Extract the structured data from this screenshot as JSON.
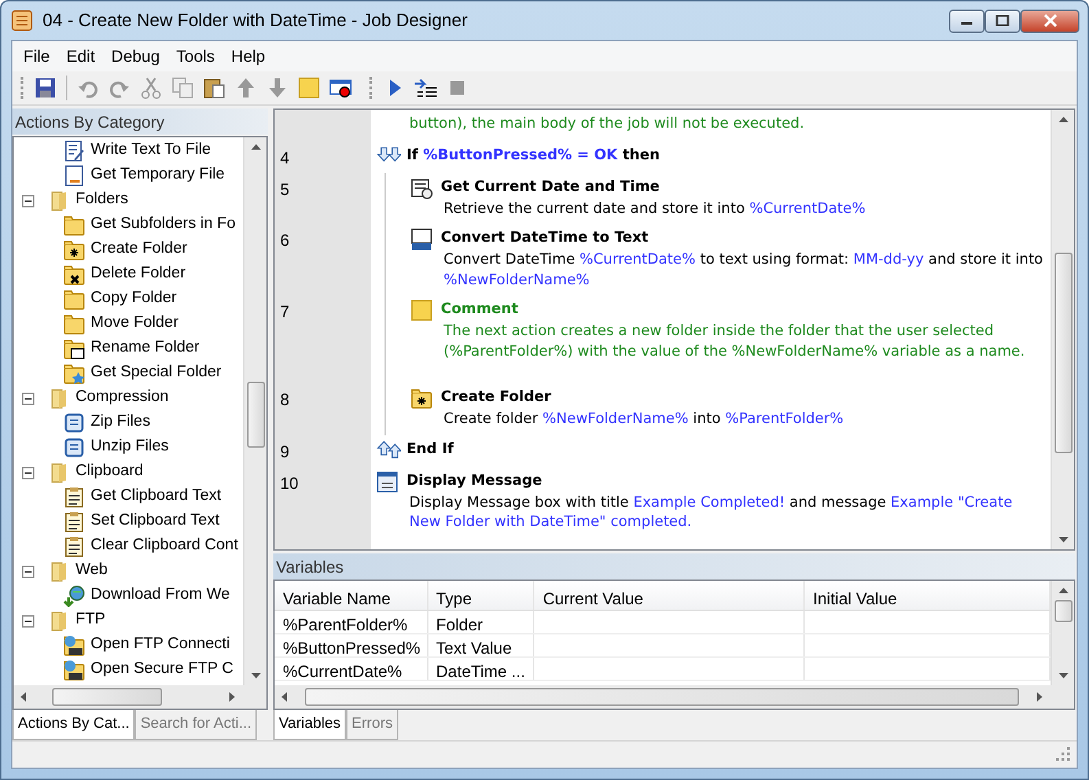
{
  "window": {
    "title": "04 - Create New Folder with DateTime - Job Designer"
  },
  "menu": [
    "File",
    "Edit",
    "Debug",
    "Tools",
    "Help"
  ],
  "actions_panel": {
    "title": "Actions By Category",
    "tree": [
      {
        "kind": "write",
        "label": "Write Text To File"
      },
      {
        "kind": "tempfile",
        "label": "Get Temporary File"
      },
      {
        "kind": "category",
        "label": "Folders",
        "expanded": true,
        "children": [
          {
            "kind": "folder",
            "label": "Get Subfolders in Fo"
          },
          {
            "kind": "folder-new",
            "label": "Create Folder"
          },
          {
            "kind": "folder-delete",
            "label": "Delete Folder"
          },
          {
            "kind": "folder",
            "label": "Copy Folder"
          },
          {
            "kind": "folder",
            "label": "Move Folder"
          },
          {
            "kind": "folder-rename",
            "label": "Rename Folder"
          },
          {
            "kind": "folder-special",
            "label": "Get Special Folder"
          }
        ]
      },
      {
        "kind": "category",
        "label": "Compression",
        "expanded": true,
        "children": [
          {
            "kind": "zip",
            "label": "Zip Files"
          },
          {
            "kind": "zip",
            "label": "Unzip Files"
          }
        ]
      },
      {
        "kind": "category",
        "label": "Clipboard",
        "expanded": true,
        "children": [
          {
            "kind": "clipboard",
            "label": "Get Clipboard Text"
          },
          {
            "kind": "clipboard",
            "label": "Set Clipboard Text"
          },
          {
            "kind": "clipboard",
            "label": "Clear Clipboard Cont"
          }
        ]
      },
      {
        "kind": "category",
        "label": "Web",
        "expanded": true,
        "children": [
          {
            "kind": "globe",
            "label": "Download From We"
          }
        ]
      },
      {
        "kind": "category",
        "label": "FTP",
        "expanded": true,
        "children": [
          {
            "kind": "ftp",
            "label": "Open FTP Connecti"
          },
          {
            "kind": "ftp",
            "label": "Open Secure FTP C"
          }
        ]
      }
    ],
    "tabs": [
      {
        "label": "Actions By Cat...",
        "selected": true
      },
      {
        "label": "Search for Acti...",
        "selected": false
      }
    ]
  },
  "editor": {
    "steps": [
      {
        "kind": "comment-tail",
        "parts": [
          {
            "text": "button), the main body of the job will not be executed."
          }
        ]
      },
      {
        "number": "4",
        "kind": "if",
        "parts": [
          {
            "text": "If ",
            "var": false
          },
          {
            "text": "%ButtonPressed% = OK",
            "var": true
          },
          {
            "text": " then",
            "var": false
          }
        ],
        "children": [
          {
            "number": "5",
            "kind": "date",
            "title": "Get Current Date and Time",
            "parts": [
              {
                "text": "Retrieve the current date and store it into ",
                "var": false
              },
              {
                "text": "%CurrentDate%",
                "var": true
              }
            ]
          },
          {
            "number": "6",
            "kind": "convert",
            "title": "Convert DateTime to Text",
            "parts": [
              {
                "text": "Convert DateTime ",
                "var": false
              },
              {
                "text": "%CurrentDate%",
                "var": true
              },
              {
                "text": " to text using format: ",
                "var": false
              },
              {
                "text": "MM-dd-yy",
                "var": true
              },
              {
                "text": " and store it into ",
                "var": false
              },
              {
                "text": "%NewFolderName%",
                "var": true
              }
            ]
          },
          {
            "number": "7",
            "kind": "comment",
            "title": "Comment",
            "parts": [
              {
                "text": "The next action creates a new folder inside the folder that the user selected (%ParentFolder%) with the value of the %NewFolderName% variable as a name."
              }
            ]
          },
          {
            "number": "8",
            "kind": "folder",
            "title": "Create Folder",
            "parts": [
              {
                "text": "Create folder ",
                "var": false
              },
              {
                "text": "%NewFolderName%",
                "var": true
              },
              {
                "text": " into ",
                "var": false
              },
              {
                "text": "%ParentFolder%",
                "var": true
              }
            ]
          }
        ]
      },
      {
        "number": "9",
        "kind": "endif",
        "title": "End If"
      },
      {
        "number": "10",
        "kind": "message",
        "title": "Display Message",
        "parts": [
          {
            "text": "Display Message box with title ",
            "var": false
          },
          {
            "text": "Example Completed!",
            "var": true
          },
          {
            "text": " and message ",
            "var": false
          },
          {
            "text": "Example \"Create New Folder with DateTime\" completed.",
            "var": true
          }
        ]
      }
    ]
  },
  "variables_panel": {
    "title": "Variables",
    "columns": [
      "Variable Name",
      "Type",
      "Current Value",
      "Initial Value"
    ],
    "rows": [
      [
        "%ParentFolder%",
        "Folder"
      ],
      [
        "%ButtonPressed%",
        "Text Value"
      ],
      [
        "%CurrentDate%",
        "DateTime ..."
      ]
    ],
    "tabs": [
      {
        "label": "Variables",
        "selected": true
      },
      {
        "label": "Errors",
        "selected": false
      }
    ]
  }
}
